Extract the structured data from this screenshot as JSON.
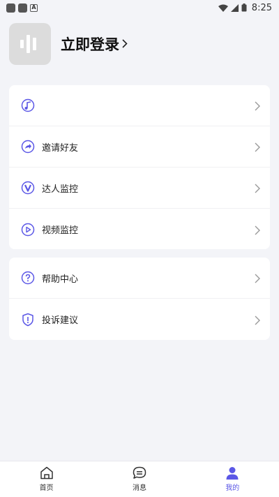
{
  "status_bar": {
    "time": "8:25"
  },
  "profile": {
    "login_label": "立即登录"
  },
  "menu_group_1": [
    {
      "label": "",
      "icon": "music-note-icon"
    },
    {
      "label": "邀请好友",
      "icon": "share-arrow-icon"
    },
    {
      "label": "达人监控",
      "icon": "v-badge-icon"
    },
    {
      "label": "视频监控",
      "icon": "play-circle-icon"
    }
  ],
  "menu_group_2": [
    {
      "label": "帮助中心",
      "icon": "question-circle-icon"
    },
    {
      "label": "投诉建议",
      "icon": "shield-alert-icon"
    }
  ],
  "tabbar": {
    "home": "首页",
    "messages": "消息",
    "mine": "我的"
  },
  "colors": {
    "accent": "#5b57e6",
    "background": "#f3f4f8"
  }
}
